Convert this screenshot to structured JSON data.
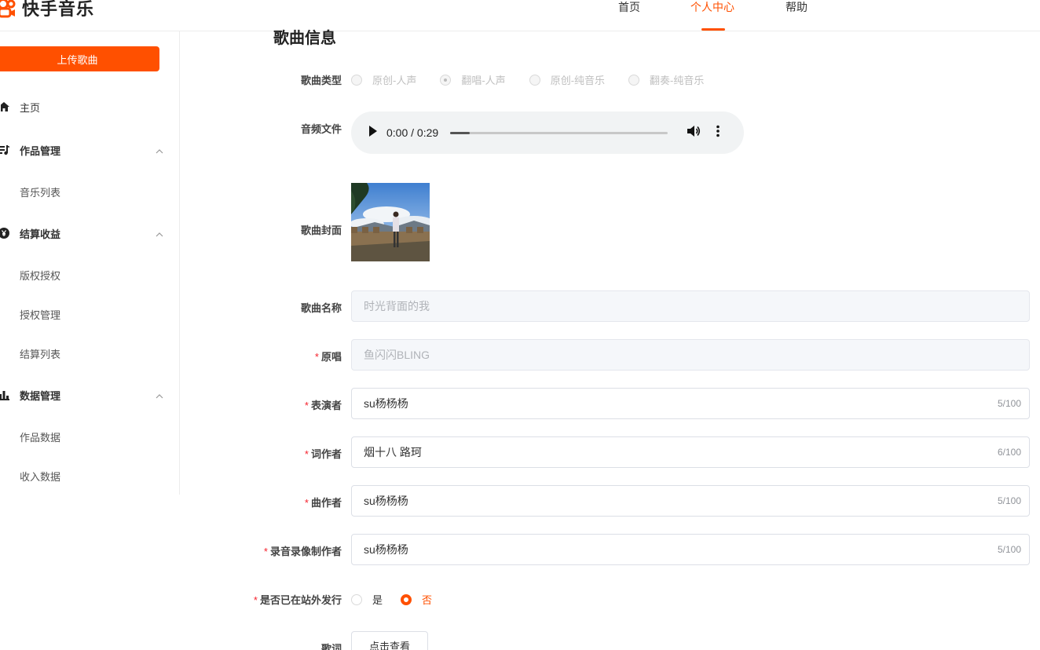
{
  "header": {
    "logo_text": "快手音乐",
    "nav": [
      {
        "label": "首页"
      },
      {
        "label": "个人中心"
      },
      {
        "label": "帮助"
      }
    ],
    "active_nav": "个人中心",
    "accent_color": "#ff5000"
  },
  "sidebar": {
    "upload_label": "上传歌曲",
    "home_label": "主页",
    "groups": [
      {
        "label": "作品管理",
        "icon": "music-list-icon",
        "items": [
          "音乐列表"
        ]
      },
      {
        "label": "结算收益",
        "icon": "yen-coin-icon",
        "items": [
          "版权授权",
          "授权管理",
          "结算列表"
        ]
      },
      {
        "label": "数据管理",
        "icon": "bar-chart-icon",
        "items": [
          "作品数据",
          "收入数据"
        ]
      }
    ]
  },
  "form": {
    "section_title": "歌曲信息",
    "song_type": {
      "label": "歌曲类型",
      "options": [
        "原创-人声",
        "翻唱-人声",
        "原创-纯音乐",
        "翻奏-纯音乐"
      ],
      "selected": "翻唱-人声"
    },
    "audio": {
      "label": "音频文件",
      "time": "0:00 / 0:29",
      "progress": 0.09
    },
    "cover": {
      "label": "歌曲封面"
    },
    "song_name": {
      "label": "歌曲名称",
      "value": "时光背面的我"
    },
    "original_singer": {
      "label": "原唱",
      "value": "鱼闪闪BLING"
    },
    "performer": {
      "label": "表演者",
      "value": "su杨杨杨",
      "count": "5/100"
    },
    "lyricist": {
      "label": "词作者",
      "value": "烟十八 路珂",
      "count": "6/100"
    },
    "composer": {
      "label": "曲作者",
      "value": "su杨杨杨",
      "count": "5/100"
    },
    "recording_producer": {
      "label": "录音录像制作者",
      "value": "su杨杨杨",
      "count": "5/100"
    },
    "released_elsewhere": {
      "label": "是否已在站外发行",
      "options": [
        "是",
        "否"
      ],
      "selected": "否"
    },
    "lyrics": {
      "label": "歌词",
      "button": "点击查看"
    }
  }
}
